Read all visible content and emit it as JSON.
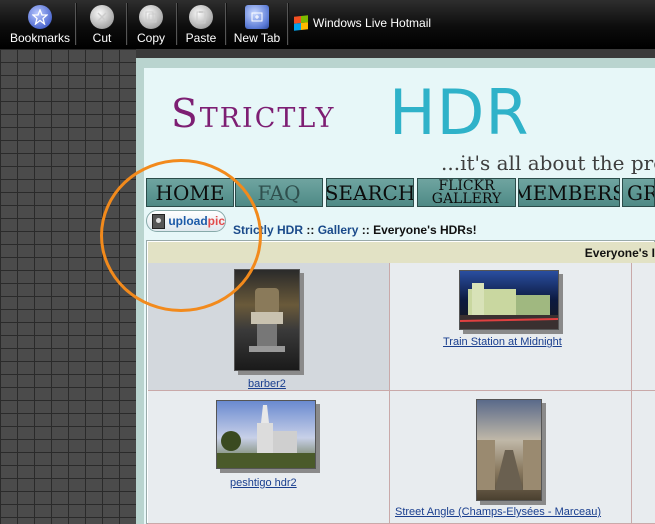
{
  "toolbar": {
    "bookmarks": "Bookmarks",
    "cut": "Cut",
    "copy": "Copy",
    "paste": "Paste",
    "new_tab": "New Tab",
    "hotmail": "Windows Live Hotmail"
  },
  "logo": {
    "strictly": "Strictly",
    "hdr": "HDR",
    "tagline": "...it's all about the proc"
  },
  "nav": {
    "home": "HOME",
    "faq": "FAQ",
    "search": "SEARCH",
    "flickr_1": "FLICKR",
    "flickr_2": "GALLERY",
    "members": "MEMBERS",
    "gr": "GR"
  },
  "upload": {
    "upload": "upload",
    "pic": "pic"
  },
  "breadcrumb": {
    "site": "Strictly HDR",
    "sep1": " :: ",
    "gallery": "Gallery",
    "sep2": " :: ",
    "current": "Everyone's HDRs!"
  },
  "gallery": {
    "header": "Everyone's I",
    "items": [
      {
        "title": "barber2"
      },
      {
        "title": "Train Station at Midnight"
      },
      {
        "title": "peshtigo hdr2"
      },
      {
        "title": "Street Angle (Champs-Elysées - Marceau)"
      }
    ]
  },
  "colors": {
    "logo_purple": "#7d1e73",
    "logo_cyan": "#2fb2c9",
    "nav_teal": "#5b9591",
    "highlight_circle": "#f28a1c",
    "link_blue": "#1a3f8f"
  }
}
